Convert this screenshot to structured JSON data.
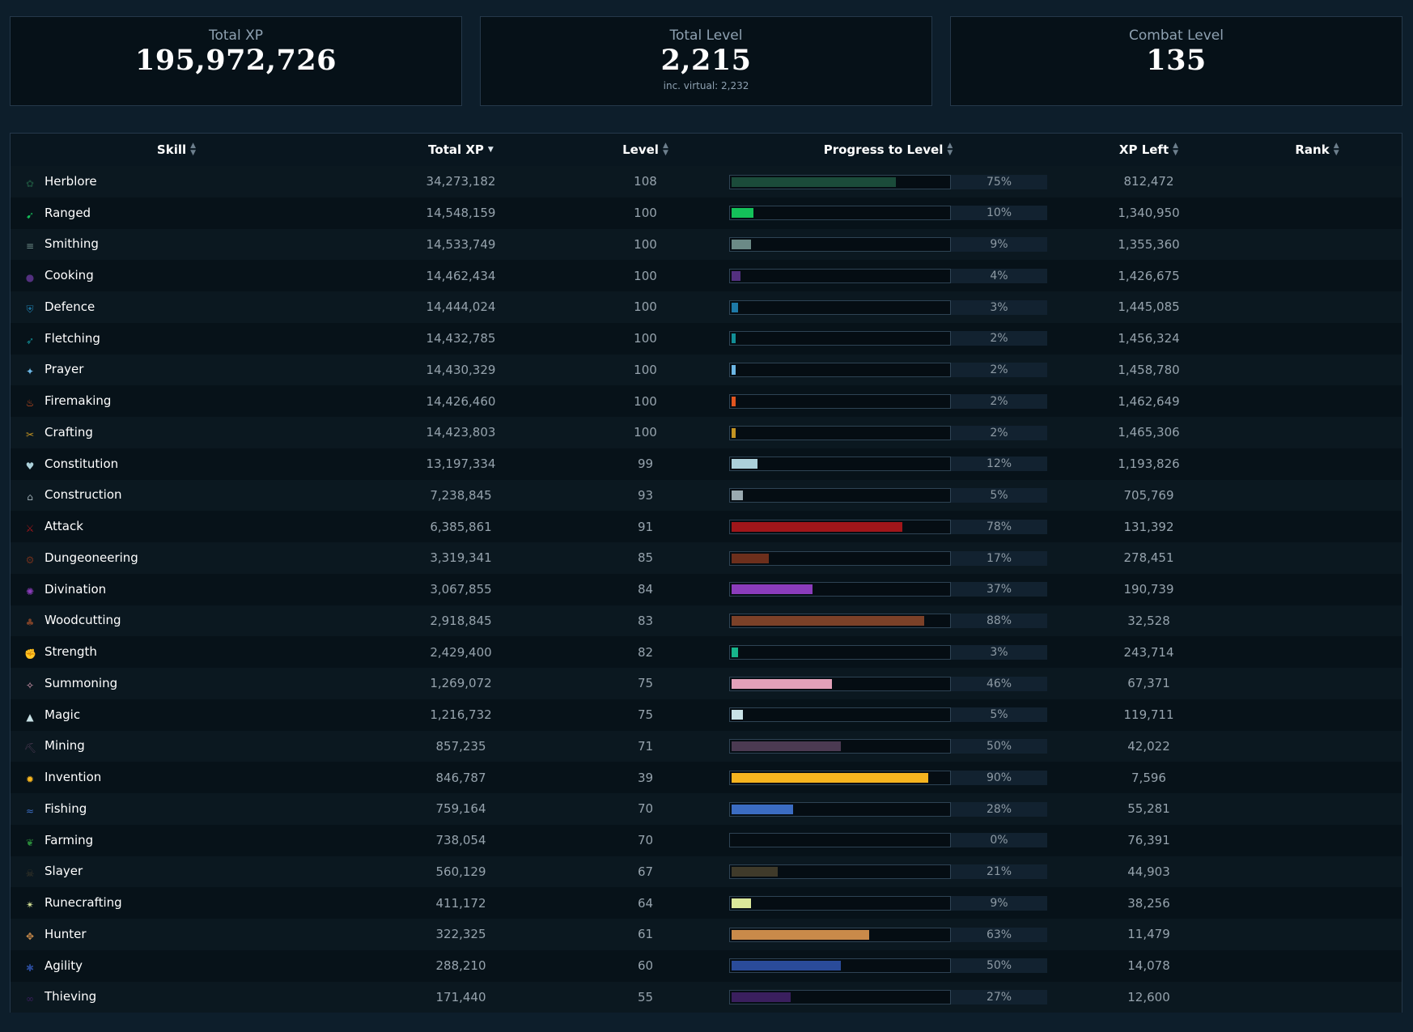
{
  "summary": {
    "total_xp": {
      "label": "Total XP",
      "value": "195,972,726"
    },
    "total_level": {
      "label": "Total Level",
      "value": "2,215",
      "sub": "inc. virtual: 2,232"
    },
    "combat_level": {
      "label": "Combat Level",
      "value": "135"
    }
  },
  "table": {
    "headers": {
      "skill": "Skill",
      "total_xp": "Total XP",
      "level": "Level",
      "progress": "Progress to Level",
      "xp_left": "XP Left",
      "rank": "Rank"
    },
    "sorted_by": "Total XP",
    "sort_direction": "descending",
    "rows": [
      {
        "skill": "Herblore",
        "icon": "herblore-icon",
        "total_xp": "34,273,182",
        "level": "108",
        "progress": "75%",
        "progress_value": 0.75,
        "color": "#1b4b3a",
        "xp_left": "812,472",
        "rank": ""
      },
      {
        "skill": "Ranged",
        "icon": "ranged-icon",
        "total_xp": "14,548,159",
        "level": "100",
        "progress": "10%",
        "progress_value": 0.1,
        "color": "#14c15a",
        "xp_left": "1,340,950",
        "rank": ""
      },
      {
        "skill": "Smithing",
        "icon": "smithing-icon",
        "total_xp": "14,533,749",
        "level": "100",
        "progress": "9%",
        "progress_value": 0.09,
        "color": "#6b8a86",
        "xp_left": "1,355,360",
        "rank": ""
      },
      {
        "skill": "Cooking",
        "icon": "cooking-icon",
        "total_xp": "14,462,434",
        "level": "100",
        "progress": "4%",
        "progress_value": 0.04,
        "color": "#53307f",
        "xp_left": "1,426,675",
        "rank": ""
      },
      {
        "skill": "Defence",
        "icon": "defence-icon",
        "total_xp": "14,444,024",
        "level": "100",
        "progress": "3%",
        "progress_value": 0.03,
        "color": "#1e7aa8",
        "xp_left": "1,445,085",
        "rank": ""
      },
      {
        "skill": "Fletching",
        "icon": "fletching-icon",
        "total_xp": "14,432,785",
        "level": "100",
        "progress": "2%",
        "progress_value": 0.02,
        "color": "#128e96",
        "xp_left": "1,456,324",
        "rank": ""
      },
      {
        "skill": "Prayer",
        "icon": "prayer-icon",
        "total_xp": "14,430,329",
        "level": "100",
        "progress": "2%",
        "progress_value": 0.02,
        "color": "#6cb6e4",
        "xp_left": "1,458,780",
        "rank": ""
      },
      {
        "skill": "Firemaking",
        "icon": "firemaking-icon",
        "total_xp": "14,426,460",
        "level": "100",
        "progress": "2%",
        "progress_value": 0.02,
        "color": "#e0551f",
        "xp_left": "1,462,649",
        "rank": ""
      },
      {
        "skill": "Crafting",
        "icon": "crafting-icon",
        "total_xp": "14,423,803",
        "level": "100",
        "progress": "2%",
        "progress_value": 0.02,
        "color": "#c49422",
        "xp_left": "1,465,306",
        "rank": ""
      },
      {
        "skill": "Constitution",
        "icon": "constitution-icon",
        "total_xp": "13,197,334",
        "level": "99",
        "progress": "12%",
        "progress_value": 0.12,
        "color": "#acd0da",
        "xp_left": "1,193,826",
        "rank": ""
      },
      {
        "skill": "Construction",
        "icon": "construction-icon",
        "total_xp": "7,238,845",
        "level": "93",
        "progress": "5%",
        "progress_value": 0.05,
        "color": "#9aaab1",
        "xp_left": "705,769",
        "rank": ""
      },
      {
        "skill": "Attack",
        "icon": "attack-icon",
        "total_xp": "6,385,861",
        "level": "91",
        "progress": "78%",
        "progress_value": 0.78,
        "color": "#a0161a",
        "xp_left": "131,392",
        "rank": ""
      },
      {
        "skill": "Dungeoneering",
        "icon": "dungeoneering-icon",
        "total_xp": "3,319,341",
        "level": "85",
        "progress": "17%",
        "progress_value": 0.17,
        "color": "#6d2f1c",
        "xp_left": "278,451",
        "rank": ""
      },
      {
        "skill": "Divination",
        "icon": "divination-icon",
        "total_xp": "3,067,855",
        "level": "84",
        "progress": "37%",
        "progress_value": 0.37,
        "color": "#8b3cbb",
        "xp_left": "190,739",
        "rank": ""
      },
      {
        "skill": "Woodcutting",
        "icon": "woodcutting-icon",
        "total_xp": "2,918,845",
        "level": "83",
        "progress": "88%",
        "progress_value": 0.88,
        "color": "#7c4128",
        "xp_left": "32,528",
        "rank": ""
      },
      {
        "skill": "Strength",
        "icon": "strength-icon",
        "total_xp": "2,429,400",
        "level": "82",
        "progress": "3%",
        "progress_value": 0.03,
        "color": "#17b48b",
        "xp_left": "243,714",
        "rank": ""
      },
      {
        "skill": "Summoning",
        "icon": "summoning-icon",
        "total_xp": "1,269,072",
        "level": "75",
        "progress": "46%",
        "progress_value": 0.46,
        "color": "#e3a1b9",
        "xp_left": "67,371",
        "rank": ""
      },
      {
        "skill": "Magic",
        "icon": "magic-icon",
        "total_xp": "1,216,732",
        "level": "75",
        "progress": "5%",
        "progress_value": 0.05,
        "color": "#c9e2e6",
        "xp_left": "119,711",
        "rank": ""
      },
      {
        "skill": "Mining",
        "icon": "mining-icon",
        "total_xp": "857,235",
        "level": "71",
        "progress": "50%",
        "progress_value": 0.5,
        "color": "#4b3a52",
        "xp_left": "42,022",
        "rank": ""
      },
      {
        "skill": "Invention",
        "icon": "invention-icon",
        "total_xp": "846,787",
        "level": "39",
        "progress": "90%",
        "progress_value": 0.9,
        "color": "#f5b41f",
        "xp_left": "7,596",
        "rank": ""
      },
      {
        "skill": "Fishing",
        "icon": "fishing-icon",
        "total_xp": "759,164",
        "level": "70",
        "progress": "28%",
        "progress_value": 0.28,
        "color": "#3b6cc2",
        "xp_left": "55,281",
        "rank": ""
      },
      {
        "skill": "Farming",
        "icon": "farming-icon",
        "total_xp": "738,054",
        "level": "70",
        "progress": "0%",
        "progress_value": 0.0,
        "color": "#2a8a3a",
        "xp_left": "76,391",
        "rank": ""
      },
      {
        "skill": "Slayer",
        "icon": "slayer-icon",
        "total_xp": "560,129",
        "level": "67",
        "progress": "21%",
        "progress_value": 0.21,
        "color": "#3f3a2a",
        "xp_left": "44,903",
        "rank": ""
      },
      {
        "skill": "Runecrafting",
        "icon": "runecrafting-icon",
        "total_xp": "411,172",
        "level": "64",
        "progress": "9%",
        "progress_value": 0.09,
        "color": "#dbe89a",
        "xp_left": "38,256",
        "rank": ""
      },
      {
        "skill": "Hunter",
        "icon": "hunter-icon",
        "total_xp": "322,325",
        "level": "61",
        "progress": "63%",
        "progress_value": 0.63,
        "color": "#c98a4a",
        "xp_left": "11,479",
        "rank": ""
      },
      {
        "skill": "Agility",
        "icon": "agility-icon",
        "total_xp": "288,210",
        "level": "60",
        "progress": "50%",
        "progress_value": 0.5,
        "color": "#2a4b9a",
        "xp_left": "14,078",
        "rank": ""
      },
      {
        "skill": "Thieving",
        "icon": "thieving-icon",
        "total_xp": "171,440",
        "level": "55",
        "progress": "27%",
        "progress_value": 0.27,
        "color": "#3a1f5e",
        "xp_left": "12,600",
        "rank": ""
      }
    ]
  }
}
